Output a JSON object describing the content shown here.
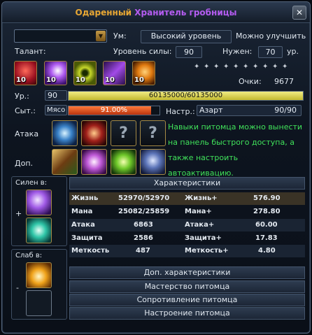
{
  "window": {
    "title_prefix": "Одаренный",
    "title_name": "Хранитель гробницы",
    "close_glyph": "✕"
  },
  "top": {
    "select_value": "",
    "um_label": "Ум:",
    "um_value": "Высокий уровень",
    "improve_link": "Можно улучшить",
    "talent_label": "Талант:",
    "power_label": "Уровень силы:",
    "power_value": "90",
    "need_label": "Нужен:",
    "need_value": "70",
    "need_suffix": "ур.",
    "points_label": "Очки:",
    "points_value": "9677"
  },
  "talents": [
    {
      "level": "10",
      "icon": "red-flame-talent-icon"
    },
    {
      "level": "10",
      "icon": "purple-burst-talent-icon"
    },
    {
      "level": "10",
      "icon": "green-eye-talent-icon"
    },
    {
      "level": "10",
      "icon": "purple-slash-talent-icon"
    },
    {
      "level": "10",
      "icon": "orange-swirl-talent-icon"
    }
  ],
  "star_count": 10,
  "level": {
    "label": "Ур.:",
    "value": "90",
    "exp_text": "60135000/60135000",
    "exp_fraction": 1.0
  },
  "satiety": {
    "label": "Сыт.:",
    "food": "Мясо",
    "percent_text": "91.00%",
    "fraction": 0.91
  },
  "mood": {
    "label": "Настр.:",
    "value": "Азарт",
    "amount": "90/90"
  },
  "skills": {
    "attack_label": "Атака",
    "extra_label": "Доп.",
    "attack": [
      "lightning-claw-skill-icon",
      "red-wings-skill-icon",
      "unknown-skill-icon",
      "unknown-skill-icon"
    ],
    "extra": [
      "earth-guard-skill-icon",
      "arcane-orbit-skill-icon",
      "nature-burst-skill-icon",
      "wolf-howl-skill-icon"
    ],
    "unknown_glyph": "?"
  },
  "info_text": "Навыки питомца можно вынести на панель быстрого доступа, а также настроить автоактивацию.",
  "strong": {
    "label": "Силен в:",
    "sign": "+",
    "icons": [
      "purple-moon-icon",
      "teal-vortex-icon"
    ]
  },
  "weak": {
    "label": "Слаб в:",
    "sign": "-",
    "icons": [
      "golden-sun-icon",
      "empty-slot"
    ]
  },
  "characteristics": {
    "header": "Характеристики",
    "rows": [
      {
        "name": "Жизнь",
        "value": "52970/52970",
        "name2": "Жизнь+",
        "value2": "576.90"
      },
      {
        "name": "Мана",
        "value": "25082/25859",
        "name2": "Мана+",
        "value2": "278.80"
      },
      {
        "name": "Атака",
        "value": "6863",
        "name2": "Атака+",
        "value2": "60.00"
      },
      {
        "name": "Защита",
        "value": "2586",
        "name2": "Защита+",
        "value2": "17.83"
      },
      {
        "name": "Меткость",
        "value": "487",
        "name2": "Меткость+",
        "value2": "4.80"
      }
    ]
  },
  "sections": [
    "Доп. характеристики",
    "Мастерство питомца",
    "Сопротивление питомца",
    "Настроение питомца"
  ],
  "colors": {
    "title_gold": "#e8a733",
    "title_purple": "#b45cf0",
    "exp_bar": "#d9d34a",
    "satiety_bar": "#d94b1c",
    "info_green": "#40e25a"
  }
}
